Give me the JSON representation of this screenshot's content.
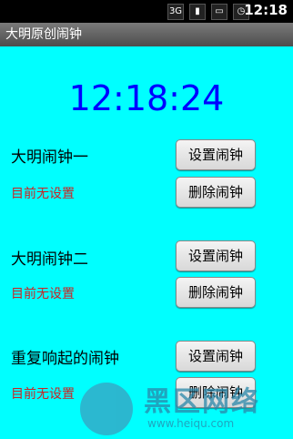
{
  "status_bar": {
    "time": "12:18",
    "icons": [
      "3g-icon",
      "signal-icon",
      "battery-icon",
      "alarm-icon"
    ]
  },
  "app": {
    "title": "大明原创闹钟"
  },
  "clock": {
    "time": "12:18:24"
  },
  "alarms": [
    {
      "label": "大明闹钟一",
      "status": "目前无设置",
      "set_label": "设置闹钟",
      "delete_label": "删除闹钟"
    },
    {
      "label": "大明闹钟二",
      "status": "目前无设置",
      "set_label": "设置闹钟",
      "delete_label": "删除闹钟"
    },
    {
      "label": "重复响起的闹钟",
      "status": "目前无设置",
      "set_label": "设置闹钟",
      "delete_label": "删除闹钟"
    }
  ],
  "watermark": {
    "text": "黑区网络",
    "url": "www.heiqu.com"
  },
  "colors": {
    "background": "#00ffff",
    "clock": "#0000ff",
    "status": "#cc2222"
  }
}
